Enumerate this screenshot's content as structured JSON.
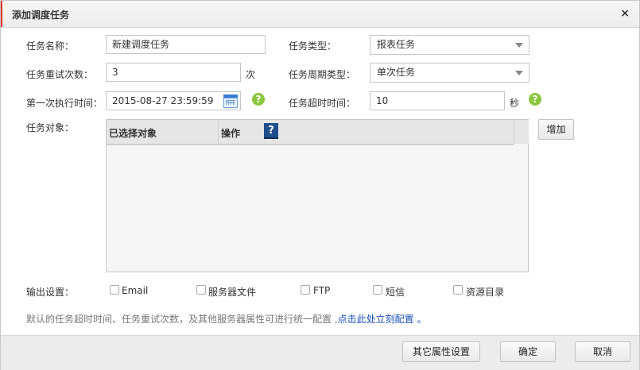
{
  "dialog": {
    "title": "添加调度任务",
    "close_symbol": "×"
  },
  "form": {
    "task_name_label": "任务名称：",
    "task_name_value": "新建调度任务",
    "task_type_label": "任务类型：",
    "task_type_value": "报表任务",
    "retry_label": "任务重试次数：",
    "retry_value": "3",
    "retry_unit": "次",
    "period_type_label": "任务周期类型：",
    "period_type_value": "单次任务",
    "first_exec_label": "第一次执行时间：",
    "first_exec_value": "2015-08-27 23:59:59",
    "timeout_label": "任务超时时间：",
    "timeout_value": "10",
    "timeout_unit": "秒",
    "help_symbol": "?",
    "target_label": "任务对象："
  },
  "targets_table": {
    "columns": [
      "已选择对象",
      "操作"
    ],
    "help_symbol": "?",
    "rows": [],
    "add_button": "增加"
  },
  "output": {
    "label": "输出设置：",
    "options": [
      {
        "label": "Email",
        "checked": false
      },
      {
        "label": "服务器文件",
        "checked": false
      },
      {
        "label": "FTP",
        "checked": false
      },
      {
        "label": "短信",
        "checked": false
      },
      {
        "label": "资源目录",
        "checked": false
      }
    ]
  },
  "hint": {
    "text": "默认的任务超时时间、任务重试次数，及其他服务器属性可进行统一配置 ,",
    "link": "点击此处立刻配置",
    "end": " 。"
  },
  "footer": {
    "other_settings": "其它属性设置",
    "ok": "确定",
    "cancel": "取消"
  },
  "colors": {
    "help_green": "#8cc63f",
    "link_blue": "#1a4fb8",
    "title_edge_red": "#e3342f"
  }
}
